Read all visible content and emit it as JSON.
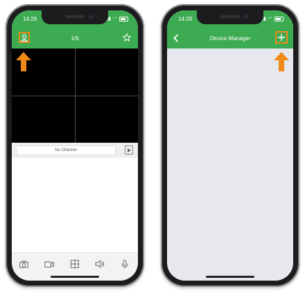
{
  "colors": {
    "accent": "#3dab52",
    "highlight": "#f08a16"
  },
  "left_phone": {
    "status": {
      "time": "14:28"
    },
    "header": {
      "title": "1/6",
      "user_icon": "user-icon",
      "favorite_icon": "star-icon"
    },
    "channel": {
      "label": "No Channel"
    },
    "toolbar": [
      "camera-icon",
      "record-icon",
      "grid-icon",
      "speaker-icon",
      "microphone-icon"
    ]
  },
  "right_phone": {
    "status": {
      "time": "14:28"
    },
    "header": {
      "title": "Device Manager",
      "back_icon": "chevron-left-icon",
      "add_icon": "plus-icon"
    }
  }
}
